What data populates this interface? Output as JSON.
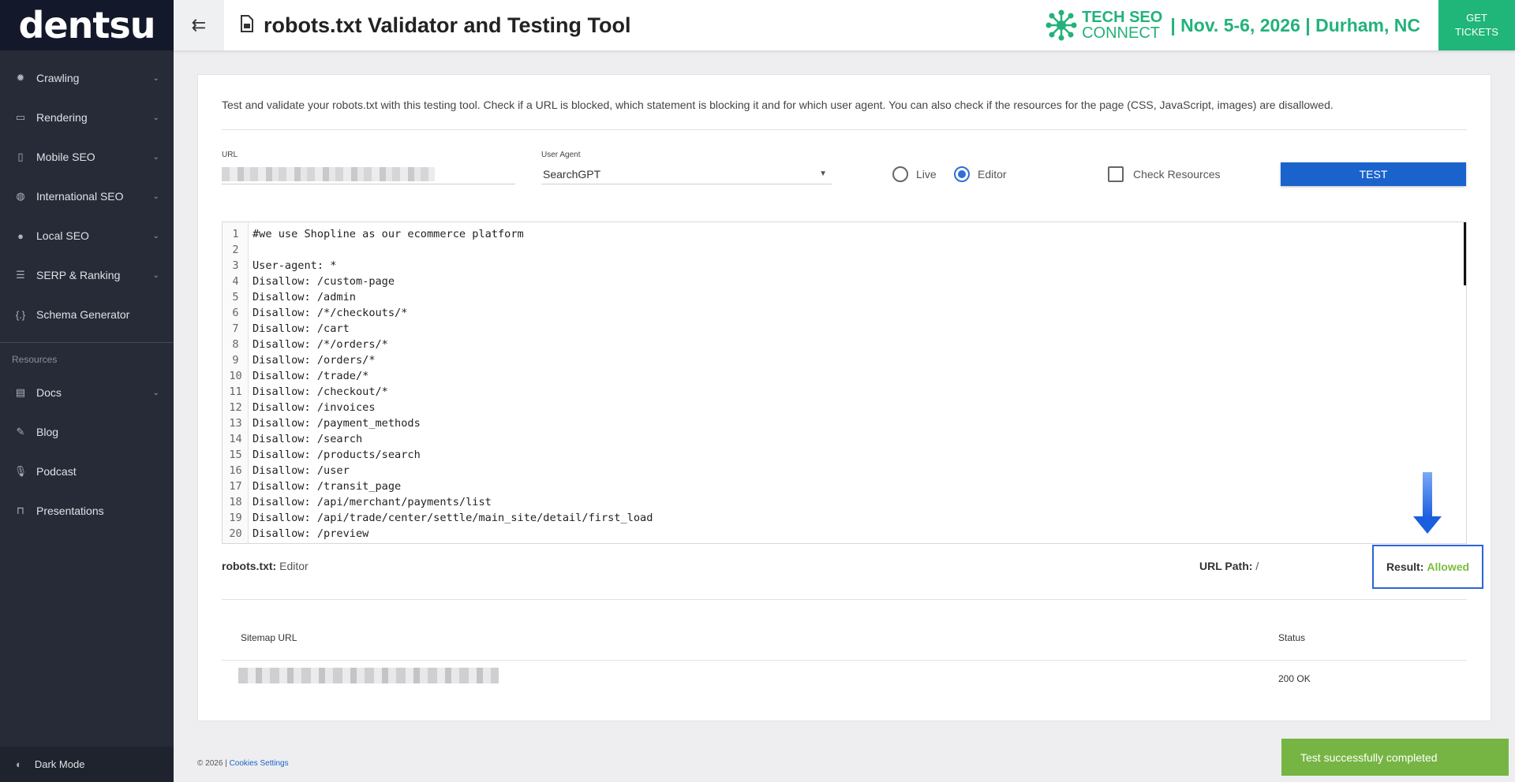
{
  "logo": "dentsu",
  "sidebar": {
    "items": [
      {
        "label": "Crawling",
        "icon": "bug-icon",
        "glyph": "✹",
        "chevron": true
      },
      {
        "label": "Rendering",
        "icon": "monitor-icon",
        "glyph": "▭",
        "chevron": true
      },
      {
        "label": "Mobile SEO",
        "icon": "mobile-icon",
        "glyph": "▯",
        "chevron": true
      },
      {
        "label": "International SEO",
        "icon": "globe-icon",
        "glyph": "◍",
        "chevron": true
      },
      {
        "label": "Local SEO",
        "icon": "map-pin-icon",
        "glyph": "●",
        "chevron": true
      },
      {
        "label": "SERP & Ranking",
        "icon": "list-icon",
        "glyph": "☰",
        "chevron": true
      },
      {
        "label": "Schema Generator",
        "icon": "braces-icon",
        "glyph": "{.}",
        "chevron": false
      }
    ],
    "section_label": "Resources",
    "resources": [
      {
        "label": "Docs",
        "icon": "docs-icon",
        "glyph": "▤",
        "chevron": true
      },
      {
        "label": "Blog",
        "icon": "pencil-icon",
        "glyph": "✎",
        "chevron": false
      },
      {
        "label": "Podcast",
        "icon": "microphone-icon",
        "glyph": "🎙",
        "chevron": false
      },
      {
        "label": "Presentations",
        "icon": "presentation-icon",
        "glyph": "⊓",
        "chevron": false
      }
    ],
    "dark_mode_label": "Dark Mode"
  },
  "header": {
    "title": "robots.txt Validator and Testing Tool",
    "promo_line1": "TECH SEO",
    "promo_line2": "CONNECT",
    "promo_text": "| Nov. 5-6, 2026 | Durham, NC",
    "tickets_line1": "GET",
    "tickets_line2": "TICKETS"
  },
  "main": {
    "intro": "Test and validate your robots.txt with this testing tool. Check if a URL is blocked, which statement is blocking it and for which user agent. You can also check if the resources for the page (CSS, JavaScript, images) are disallowed.",
    "url_label": "URL",
    "user_agent_label": "User Agent",
    "user_agent_value": "SearchGPT",
    "radio_live": "Live",
    "radio_editor": "Editor",
    "check_resources": "Check Resources",
    "test_button": "TEST",
    "editor_lines": [
      "#we use Shopline as our ecommerce platform",
      "",
      "User-agent: *",
      "Disallow: /custom-page",
      "Disallow: /admin",
      "Disallow: /*/checkouts/*",
      "Disallow: /cart",
      "Disallow: /*/orders/*",
      "Disallow: /orders/*",
      "Disallow: /trade/*",
      "Disallow: /checkout/*",
      "Disallow: /invoices",
      "Disallow: /payment_methods",
      "Disallow: /search",
      "Disallow: /products/search",
      "Disallow: /user",
      "Disallow: /transit_page",
      "Disallow: /api/merchant/payments/list",
      "Disallow: /api/trade/center/settle/main_site/detail/first_load",
      "Disallow: /preview"
    ],
    "robots_label": "robots.txt:",
    "robots_value": "Editor",
    "url_path_label": "URL Path:",
    "url_path_value": "/",
    "result_label": "Result:",
    "result_value": "Allowed",
    "table_header_sitemap": "Sitemap URL",
    "table_header_status": "Status",
    "sitemap_status": "200 OK"
  },
  "footer": {
    "copyright": "© 2026 |",
    "cookies_link": "Cookies Settings"
  },
  "toast": "Test successfully completed",
  "colors": {
    "sidebar_bg": "#262b37",
    "accent_green": "#20b67a",
    "primary_blue": "#1a63cc",
    "allowed_green": "#7bbd3d",
    "toast_green": "#76b544"
  }
}
